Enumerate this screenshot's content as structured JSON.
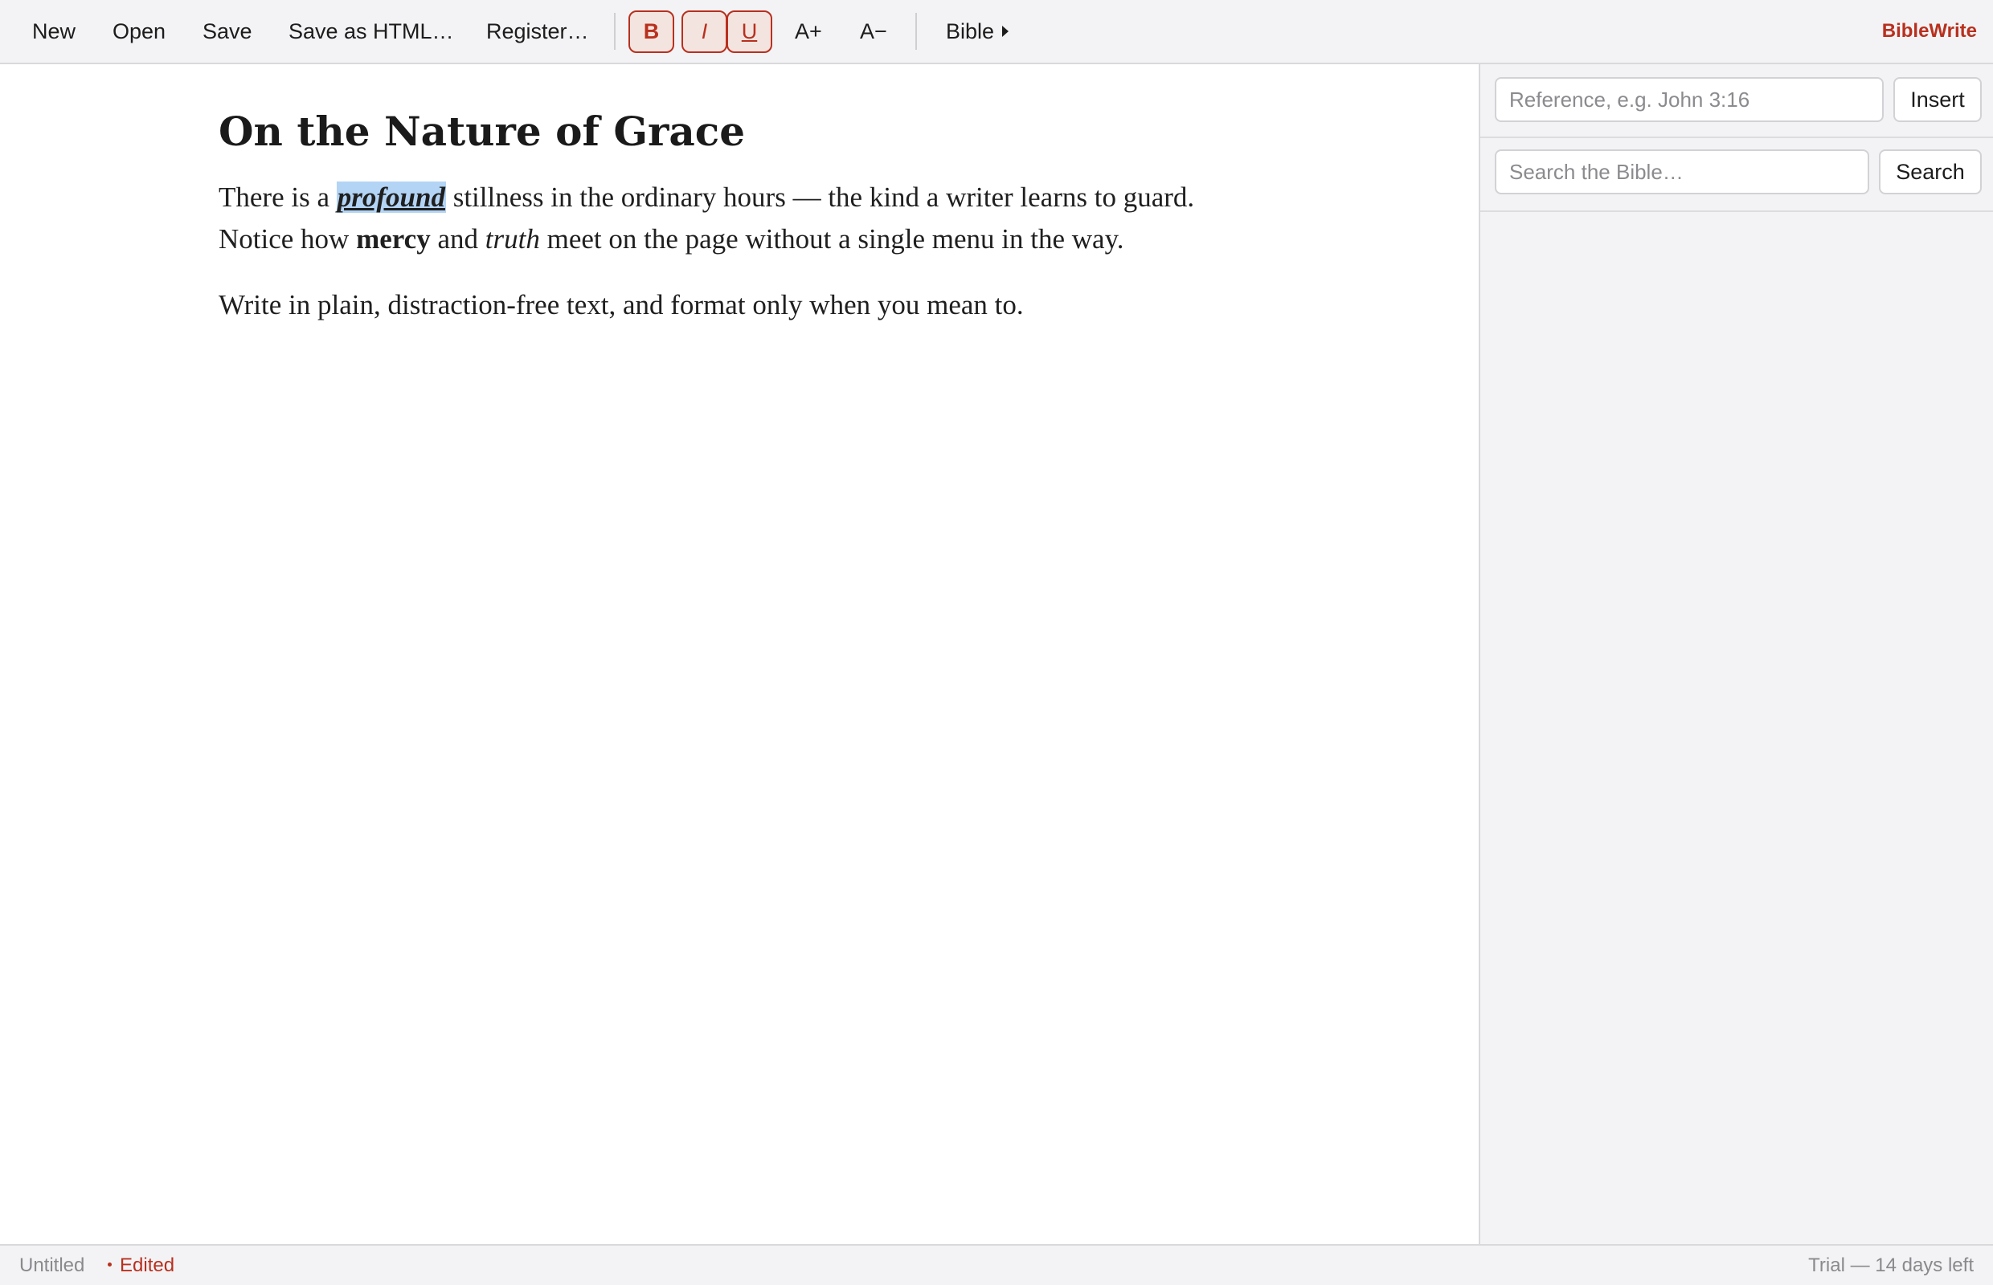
{
  "app": {
    "brand": "BibleWrite",
    "accent_color": "#b8301e"
  },
  "toolbar": {
    "new": "New",
    "open": "Open",
    "save": "Save",
    "save_html": "Save as HTML…",
    "register": "Register…",
    "bold": "B",
    "italic": "I",
    "underline": "U",
    "font_larger": "A+",
    "font_smaller": "A−",
    "bible_menu": "Bible"
  },
  "document": {
    "title": "On the Nature of Grace",
    "p1": {
      "a": "There is a ",
      "selected": "profound",
      "b": " stillness in the ordinary hours — the kind a writer learns to guard.",
      "c": "Notice how ",
      "bold": "mercy",
      "d": " and ",
      "italic": "truth",
      "e": " meet on the page without a single menu in the way."
    },
    "p2": "Write in plain, distraction-free text, and format only when you mean to."
  },
  "sidebar": {
    "reference_placeholder": "Reference, e.g. John 3:16",
    "insert_label": "Insert",
    "search_placeholder": "Search the Bible…",
    "search_label": "Search"
  },
  "status": {
    "doc_name": "Untitled",
    "edited": "Edited",
    "trial": "Trial — 14 days left"
  }
}
